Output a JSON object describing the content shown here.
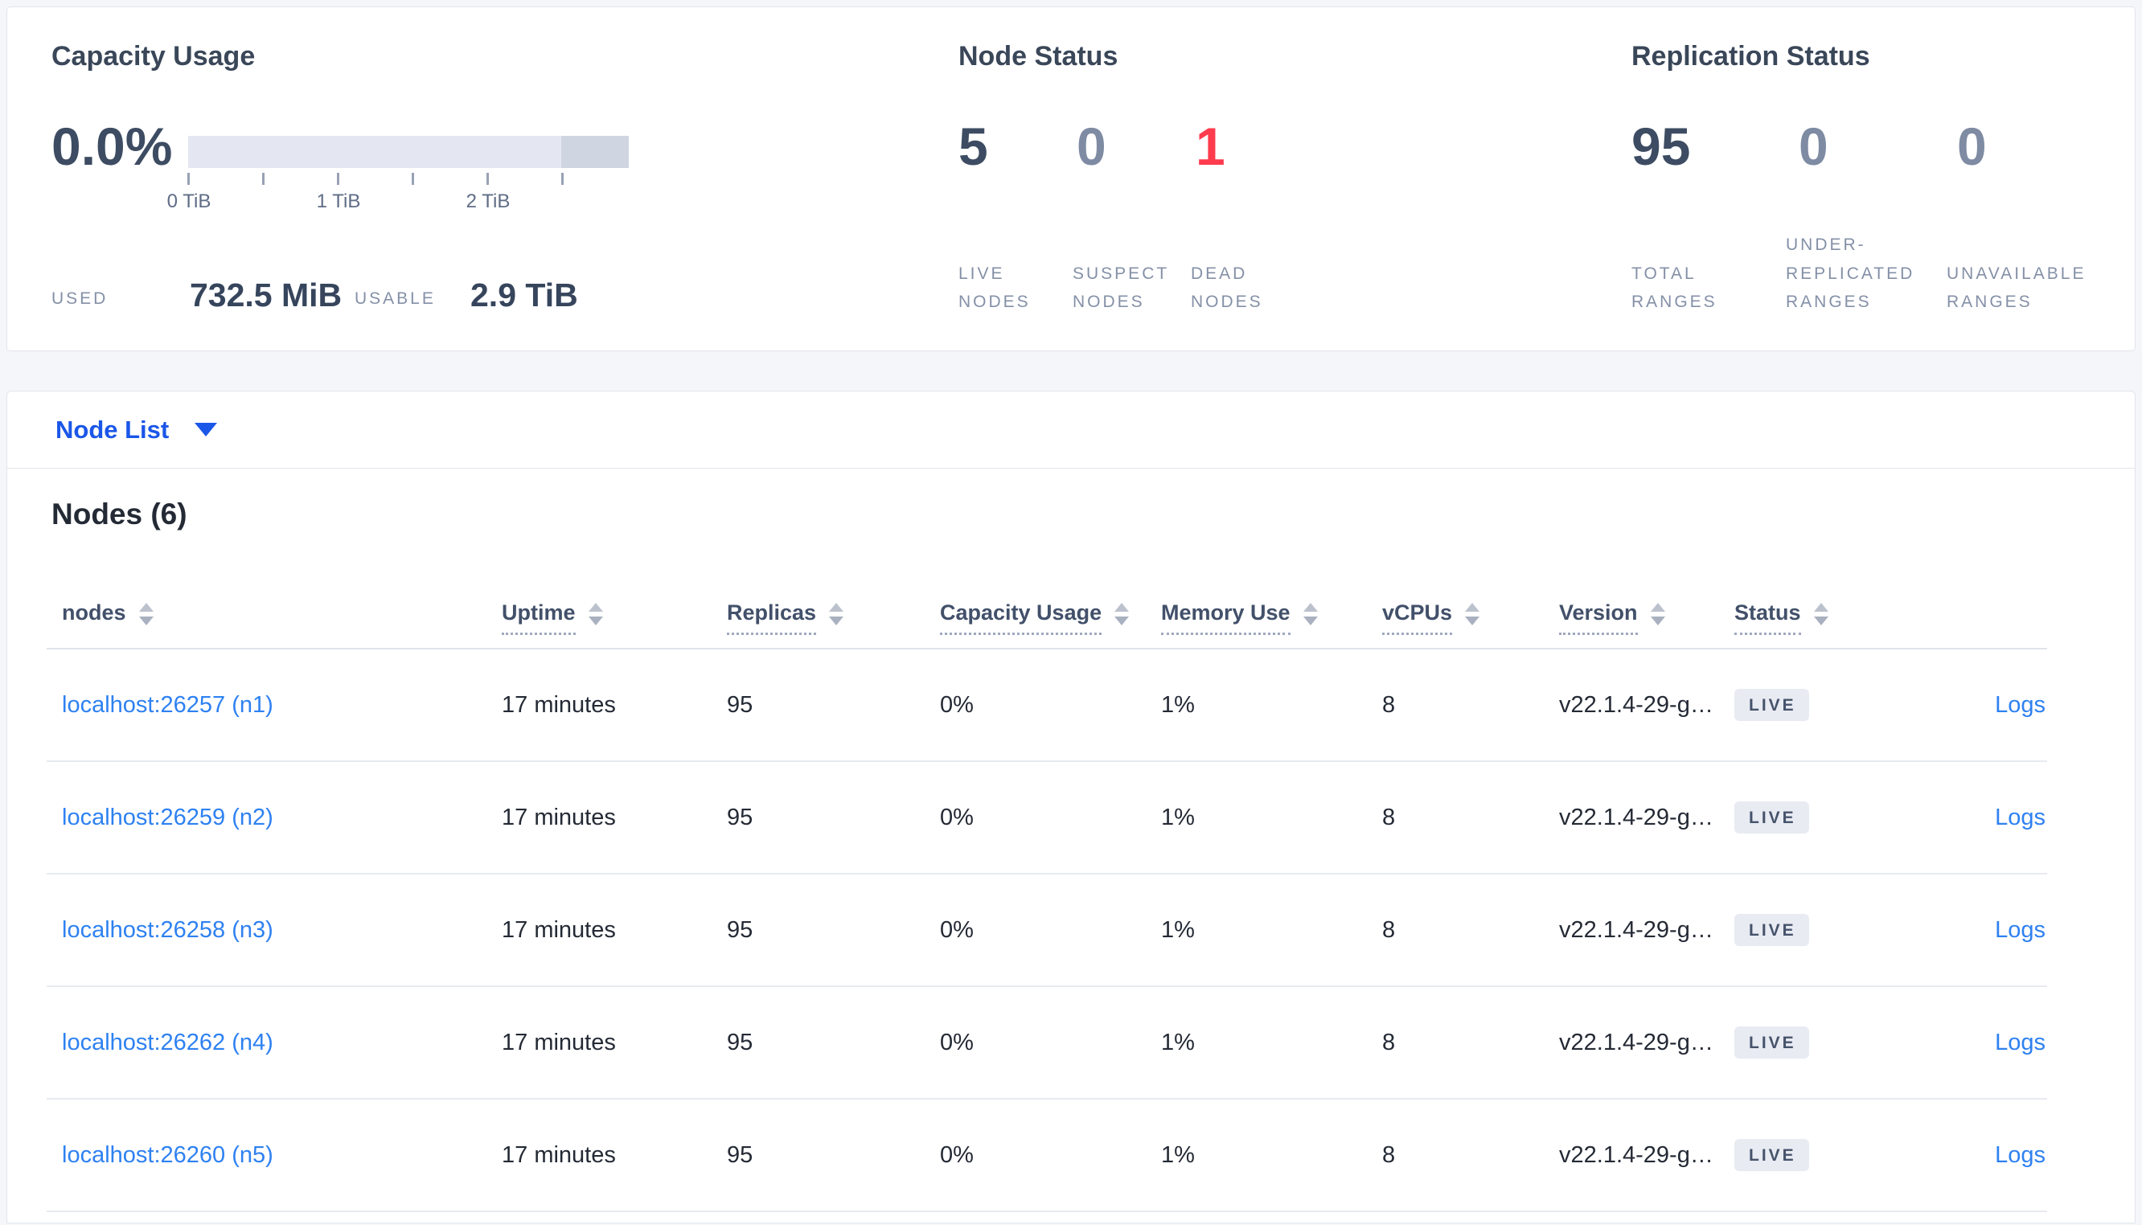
{
  "colors": {
    "page_background": "#f4f6f9",
    "panel_background": "#ffffff",
    "link_blue": "#2e81f1",
    "dropdown_blue": "#1a56e8",
    "dead_red": "#ff3b4e",
    "dark_number": "#3d4c62",
    "muted_number": "#7e8ba3",
    "badge_background": "#e8ebf2",
    "capacity_bar_light": "#e4e7f1",
    "capacity_bar_dark": "#d0d5e2"
  },
  "capacity": {
    "title": "Capacity Usage",
    "percent": "0.0%",
    "tick_labels": [
      "0 TiB",
      "1 TiB",
      "2 TiB"
    ],
    "used_label": "USED",
    "used_value": "732.5 MiB",
    "usable_label": "USABLE",
    "usable_value": "2.9 TiB"
  },
  "node_status": {
    "title": "Node Status",
    "stats": [
      {
        "value": "5",
        "label": "LIVE NODES"
      },
      {
        "value": "0",
        "label": "SUSPECT NODES"
      },
      {
        "value": "1",
        "label": "DEAD NODES"
      }
    ]
  },
  "replication": {
    "title": "Replication Status",
    "stats": [
      {
        "value": "95",
        "label": "TOTAL RANGES"
      },
      {
        "value": "0",
        "label": "UNDER-REPLICATED RANGES"
      },
      {
        "value": "0",
        "label": "UNAVAILABLE RANGES"
      }
    ]
  },
  "node_list": {
    "label": "Node List"
  },
  "nodes_section": {
    "title": "Nodes (6)"
  },
  "table": {
    "headers": [
      "nodes",
      "Uptime",
      "Replicas",
      "Capacity Usage",
      "Memory Use",
      "vCPUs",
      "Version",
      "Status"
    ],
    "rows": [
      {
        "node": "localhost:26257 (n1)",
        "uptime": "17 minutes",
        "replicas": "95",
        "capacity": "0%",
        "memory": "1%",
        "vcpus": "8",
        "version": "v22.1.4-29-g…",
        "status": "LIVE",
        "logs": "Logs"
      },
      {
        "node": "localhost:26259 (n2)",
        "uptime": "17 minutes",
        "replicas": "95",
        "capacity": "0%",
        "memory": "1%",
        "vcpus": "8",
        "version": "v22.1.4-29-g…",
        "status": "LIVE",
        "logs": "Logs"
      },
      {
        "node": "localhost:26258 (n3)",
        "uptime": "17 minutes",
        "replicas": "95",
        "capacity": "0%",
        "memory": "1%",
        "vcpus": "8",
        "version": "v22.1.4-29-g…",
        "status": "LIVE",
        "logs": "Logs"
      },
      {
        "node": "localhost:26262 (n4)",
        "uptime": "17 minutes",
        "replicas": "95",
        "capacity": "0%",
        "memory": "1%",
        "vcpus": "8",
        "version": "v22.1.4-29-g…",
        "status": "LIVE",
        "logs": "Logs"
      },
      {
        "node": "localhost:26260 (n5)",
        "uptime": "17 minutes",
        "replicas": "95",
        "capacity": "0%",
        "memory": "1%",
        "vcpus": "8",
        "version": "v22.1.4-29-g…",
        "status": "LIVE",
        "logs": "Logs"
      }
    ]
  }
}
